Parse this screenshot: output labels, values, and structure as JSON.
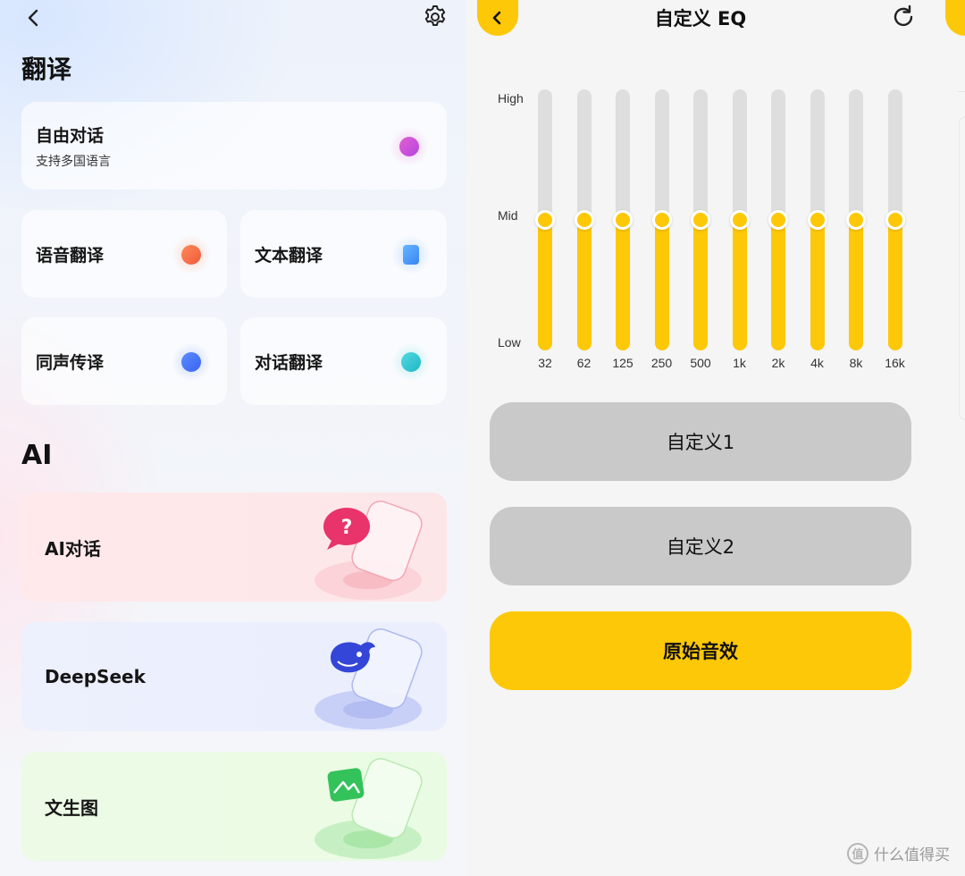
{
  "left": {
    "translate_title": "翻译",
    "free_dialog": {
      "label": "自由对话",
      "sub": "支持多国语言",
      "icon": "chat-smile-icon"
    },
    "tiles": [
      {
        "label": "语音翻译",
        "icon": "voice-wave-icon"
      },
      {
        "label": "文本翻译",
        "icon": "document-icon"
      },
      {
        "label": "同声传译",
        "icon": "chat-bubble-icon"
      },
      {
        "label": "对话翻译",
        "icon": "chat-lines-icon"
      }
    ],
    "ai_title": "AI",
    "ai_items": [
      {
        "label": "AI对话",
        "icon": "question-bubble-icon",
        "accent": "#e8336b"
      },
      {
        "label": "DeepSeek",
        "icon": "whale-icon",
        "accent": "#3446d8"
      },
      {
        "label": "文生图",
        "icon": "image-icon",
        "accent": "#34c25b"
      }
    ]
  },
  "right": {
    "title": "自定义 EQ",
    "levels": {
      "high": "High",
      "mid": "Mid",
      "low": "Low"
    },
    "bands": [
      {
        "label": "32",
        "level": 0.5
      },
      {
        "label": "62",
        "level": 0.5
      },
      {
        "label": "125",
        "level": 0.5
      },
      {
        "label": "250",
        "level": 0.5
      },
      {
        "label": "500",
        "level": 0.5
      },
      {
        "label": "1k",
        "level": 0.5
      },
      {
        "label": "2k",
        "level": 0.5
      },
      {
        "label": "4k",
        "level": 0.5
      },
      {
        "label": "8k",
        "level": 0.5
      },
      {
        "label": "16k",
        "level": 0.5
      }
    ],
    "presets": [
      "自定义1",
      "自定义2",
      "原始音效"
    ],
    "accent": "#fdc807"
  },
  "watermark": {
    "text": "什么值得买",
    "logo": "值"
  }
}
